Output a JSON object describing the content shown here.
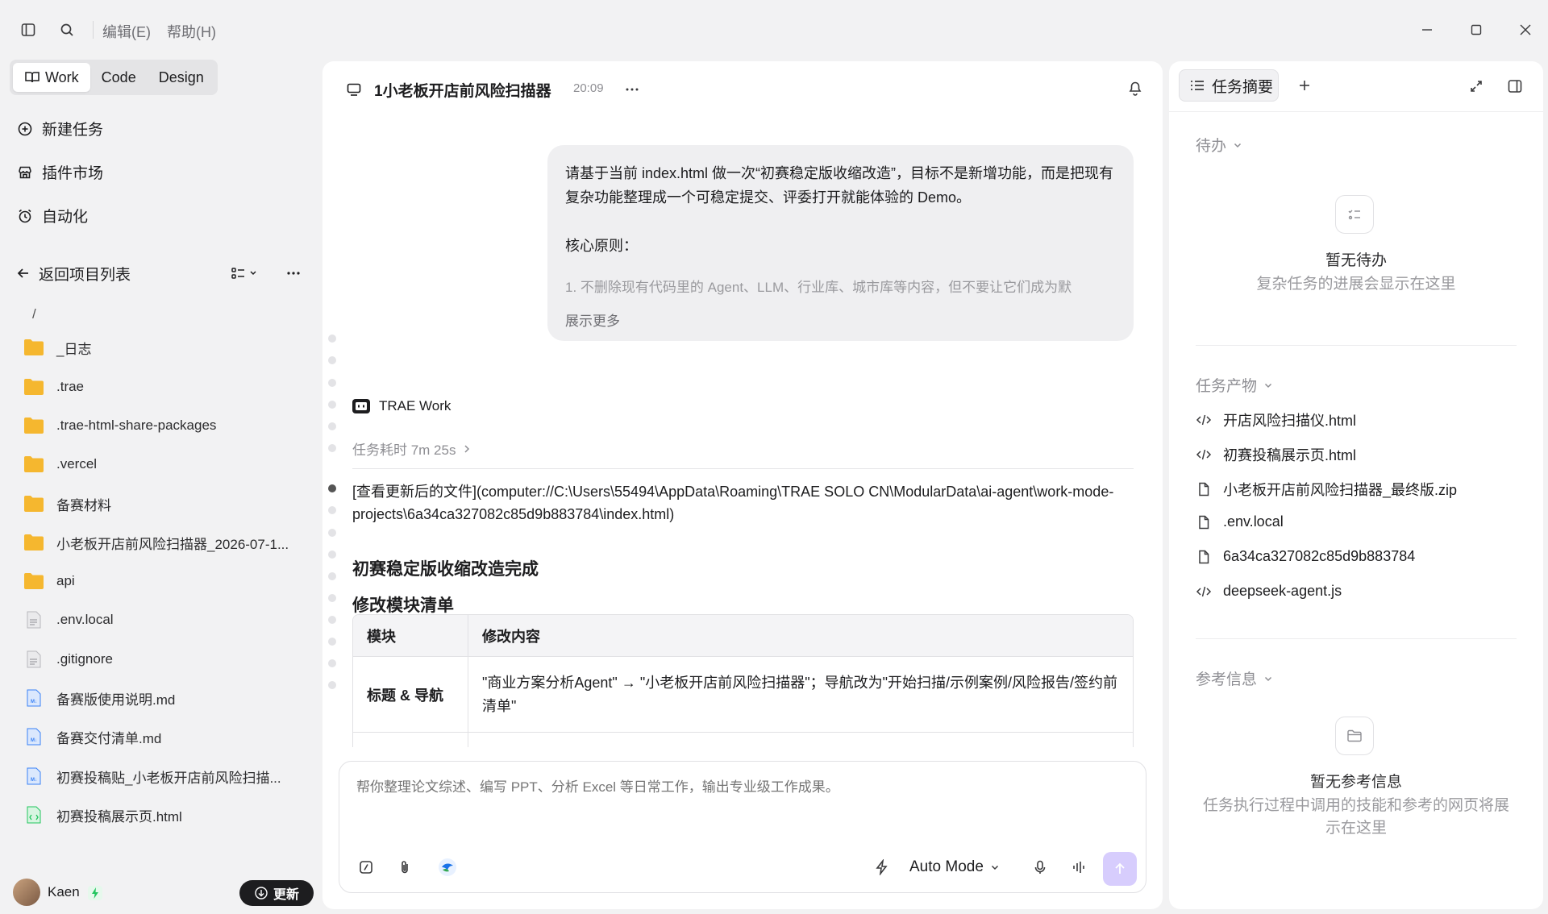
{
  "titlebar": {
    "menus": [
      "编辑(E)",
      "帮助(H)"
    ]
  },
  "sidebar": {
    "modes": [
      "Work",
      "Code",
      "Design"
    ],
    "nav": [
      "新建任务",
      "插件市场",
      "自动化"
    ],
    "back_label": "返回项目列表",
    "root": "/",
    "files": [
      {
        "name": "_日志",
        "type": "folder"
      },
      {
        "name": ".trae",
        "type": "folder"
      },
      {
        "name": ".trae-html-share-packages",
        "type": "folder"
      },
      {
        "name": ".vercel",
        "type": "folder"
      },
      {
        "name": "备赛材料",
        "type": "folder"
      },
      {
        "name": "小老板开店前风险扫描器_2026-07-1...",
        "type": "folder"
      },
      {
        "name": "api",
        "type": "folder"
      },
      {
        "name": ".env.local",
        "type": "text"
      },
      {
        "name": ".gitignore",
        "type": "text"
      },
      {
        "name": "备赛版使用说明.md",
        "type": "markdown"
      },
      {
        "name": "备赛交付清单.md",
        "type": "markdown"
      },
      {
        "name": "初赛投稿贴_小老板开店前风险扫描...",
        "type": "markdown"
      },
      {
        "name": "初赛投稿展示页.html",
        "type": "html"
      }
    ],
    "user_name": "Kaen",
    "update_label": "更新"
  },
  "chat": {
    "title": "1小老板开店前风险扫描器",
    "time": "20:09",
    "user_message": {
      "line1": "请基于当前 index.html 做一次“初赛稳定版收缩改造”，目标不是新增功能，而是把现有复杂功能整理成一个可稳定提交、评委打开就能体验的 Demo。",
      "line2": "核心原则：",
      "line3": "1. 不删除现有代码里的 Agent、LLM、行业库、城市库等内容，但不要让它们成为默",
      "show_more": "展示更多"
    },
    "assistant_name": "TRAE Work",
    "duration": "任务耗时 7m 25s",
    "file_link": "[查看更新后的文件](computer://C:\\Users\\55494\\AppData\\Roaming\\TRAE SOLO CN\\ModularData\\ai-agent\\work-mode-projects\\6a34ca327082c85d9b883784\\index.html)",
    "heading1": "初赛稳定版收缩改造完成",
    "heading2": "修改模块清单",
    "table": {
      "headers": [
        "模块",
        "修改内容"
      ],
      "rows": [
        [
          "标题 & 导航",
          "\"商业方案分析Agent\" → \"小老板开店前风险扫描器\"；导航改为\"开始扫描/示例案例/风险报告/签约前清单\""
        ]
      ]
    },
    "composer_placeholder": "帮你整理论文综述、编写 PPT、分析 Excel 等日常工作，输出专业级工作成果。",
    "mode_label": "Auto Mode"
  },
  "right_panel": {
    "tab_label": "任务摘要",
    "todo": {
      "title": "待办",
      "empty_title": "暂无待办",
      "empty_sub": "复杂任务的进展会显示在这里"
    },
    "artifacts": {
      "title": "任务产物",
      "items": [
        {
          "name": "开店风险扫描仪.html",
          "icon": "code-icon"
        },
        {
          "name": "初赛投稿展示页.html",
          "icon": "code-icon"
        },
        {
          "name": "小老板开店前风险扫描器_最终版.zip",
          "icon": "file-icon"
        },
        {
          "name": ".env.local",
          "icon": "file-icon"
        },
        {
          "name": "6a34ca327082c85d9b883784",
          "icon": "file-icon"
        },
        {
          "name": "deepseek-agent.js",
          "icon": "code-icon"
        }
      ]
    },
    "reference": {
      "title": "参考信息",
      "empty_title": "暂无参考信息",
      "empty_sub": "任务执行过程中调用的技能和参考的网页将展示在这里"
    }
  },
  "colors": {
    "accent_send": "#d7cdfd",
    "folder": "#f5b72f",
    "markdown": "#3b82f6",
    "html": "#22c55e"
  }
}
